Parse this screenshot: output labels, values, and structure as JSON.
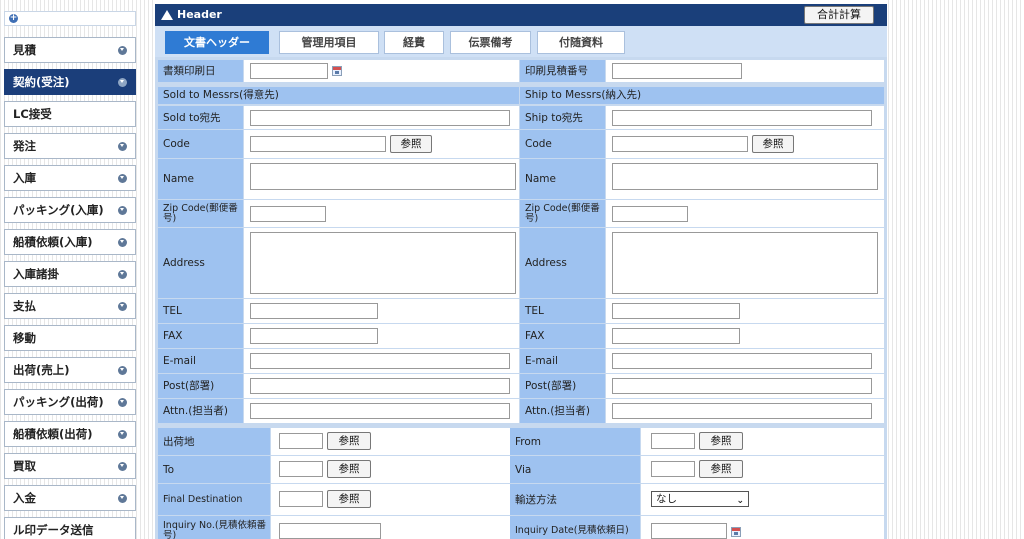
{
  "sidebar": {
    "items": [
      {
        "label": "見積",
        "bullet": true,
        "active": false
      },
      {
        "label": "契約(受注)",
        "bullet": true,
        "active": true
      },
      {
        "label": "LC接受",
        "bullet": false,
        "active": false
      },
      {
        "label": "発注",
        "bullet": true,
        "active": false
      },
      {
        "label": "入庫",
        "bullet": true,
        "active": false
      },
      {
        "label": "パッキング(入庫)",
        "bullet": true,
        "active": false
      },
      {
        "label": "船積依頼(入庫)",
        "bullet": true,
        "active": false
      },
      {
        "label": "入庫諸掛",
        "bullet": true,
        "active": false
      },
      {
        "label": "支払",
        "bullet": true,
        "active": false
      },
      {
        "label": "移動",
        "bullet": false,
        "active": false
      },
      {
        "label": "出荷(売上)",
        "bullet": true,
        "active": false
      },
      {
        "label": "パッキング(出荷)",
        "bullet": true,
        "active": false
      },
      {
        "label": "船積依頼(出荷)",
        "bullet": true,
        "active": false
      },
      {
        "label": "買取",
        "bullet": true,
        "active": false
      },
      {
        "label": "入金",
        "bullet": true,
        "active": false
      },
      {
        "label": "ル印データ送信",
        "bullet": false,
        "active": false
      }
    ]
  },
  "header": {
    "title": "Header",
    "total_button": "合計計算"
  },
  "tabs": [
    {
      "label": "文書ヘッダー",
      "active": true
    },
    {
      "label": "管理用項目",
      "active": false
    },
    {
      "label": "経費",
      "active": false
    },
    {
      "label": "伝票備考",
      "active": false
    },
    {
      "label": "付随資料",
      "active": false
    }
  ],
  "form": {
    "print_date_label": "書類印刷日",
    "print_quote_no_label": "印刷見積番号",
    "sold_section": "Sold to Messrs(得意先)",
    "ship_section": "Ship to Messrs(納入先)",
    "ref_button": "参照",
    "left": {
      "dest": "Sold to宛先",
      "code": "Code",
      "name": "Name",
      "zip": "Zip Code(郵便番号)",
      "address": "Address",
      "tel": "TEL",
      "fax": "FAX",
      "email": "E-mail",
      "post": "Post(部署)",
      "attn": "Attn.(担当者)"
    },
    "right": {
      "dest": "Ship to宛先",
      "code": "Code",
      "name": "Name",
      "zip": "Zip Code(郵便番号)",
      "address": "Address",
      "tel": "TEL",
      "fax": "FAX",
      "email": "E-mail",
      "post": "Post(部署)",
      "attn": "Attn.(担当者)"
    },
    "shipping": {
      "origin": "出荷地",
      "to": "To",
      "final_dest": "Final Destination",
      "inquiry_no": "Inquiry No.(見積依頼番号)",
      "from": "From",
      "via": "Via",
      "transport": "輸送方法",
      "transport_value": "なし",
      "inquiry_date": "Inquiry Date(見積依頼日)"
    }
  }
}
